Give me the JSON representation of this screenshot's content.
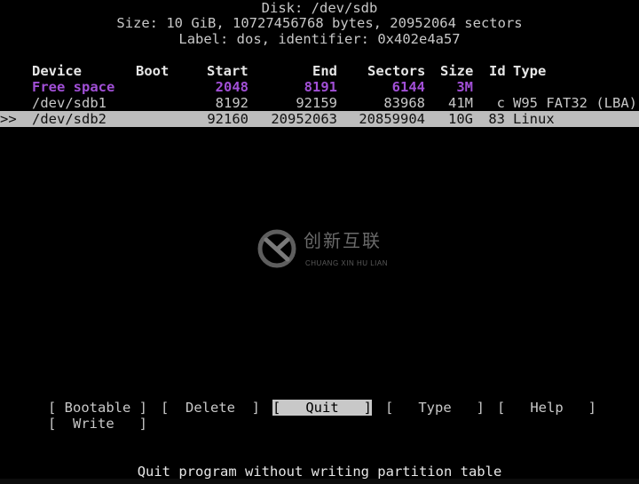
{
  "disk": {
    "title": "Disk: /dev/sdb",
    "size_line": "Size: 10 GiB, 10727456768 bytes, 20952064 sectors",
    "label_line": "Label: dos, identifier: 0x402e4a57"
  },
  "table": {
    "headers": {
      "device": "Device",
      "boot": "Boot",
      "start": "Start",
      "end": "End",
      "sectors": "Sectors",
      "size": "Size",
      "id": "Id",
      "type": "Type"
    },
    "rows": [
      {
        "marker": "",
        "device": "Free space",
        "boot": "",
        "start": "2048",
        "end": "8191",
        "sectors": "6144",
        "size": "3M",
        "id": "",
        "type": ""
      },
      {
        "marker": "",
        "device": "/dev/sdb1",
        "boot": "",
        "start": "8192",
        "end": "92159",
        "sectors": "83968",
        "size": "41M",
        "id": "c",
        "type": "W95 FAT32 (LBA)"
      },
      {
        "marker": ">>",
        "device": "/dev/sdb2",
        "boot": "",
        "start": "92160",
        "end": "20952063",
        "sectors": "20859904",
        "size": "10G",
        "id": "83",
        "type": "Linux"
      }
    ]
  },
  "menu": {
    "bootable": "[ Bootable ]",
    "delete": "[  Delete  ]",
    "quit": "[   Quit   ]",
    "type": "[   Type   ]",
    "help": "[   Help   ]",
    "write": "[  Write   ]"
  },
  "status": "Quit program without writing partition table",
  "watermark": {
    "cn": "创新互联",
    "en": "CHUANG XIN HU LIAN"
  },
  "colors": {
    "free_space": "#a14fd6",
    "selection_bg": "#bdbdbd",
    "background": "#000000"
  }
}
